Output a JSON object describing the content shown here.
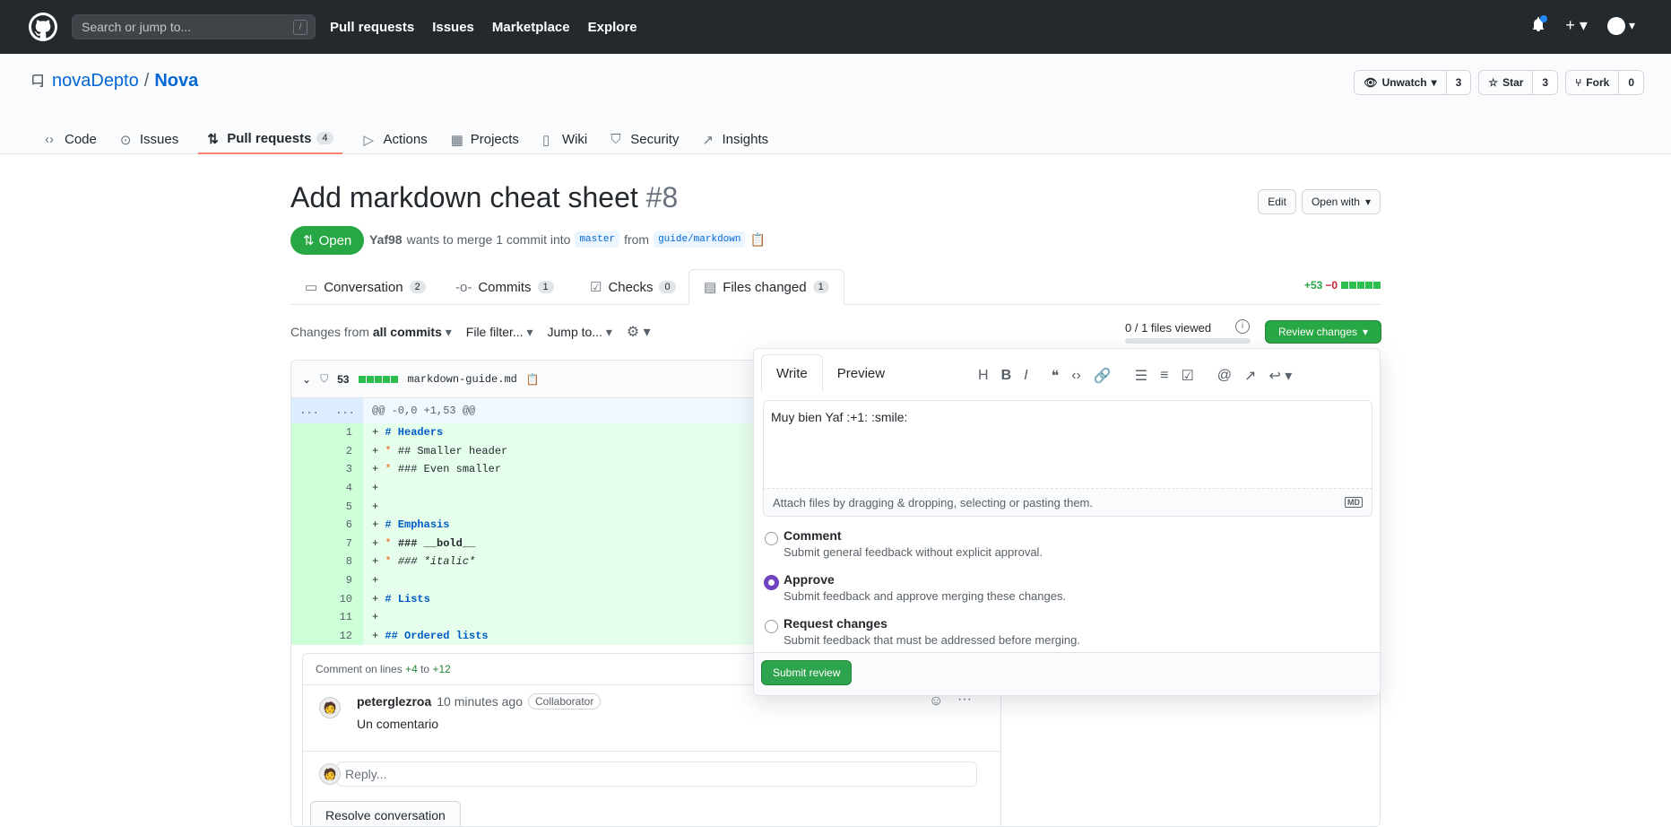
{
  "topbar": {
    "search_placeholder": "Search or jump to...",
    "slash_hint": "/",
    "nav": [
      "Pull requests",
      "Issues",
      "Marketplace",
      "Explore"
    ]
  },
  "repo": {
    "owner": "novaDepto",
    "separator": "/",
    "name": "Nova",
    "watch_label": "Unwatch",
    "watch_count": "3",
    "star_label": "Star",
    "star_count": "3",
    "fork_label": "Fork",
    "fork_count": "0",
    "nav": [
      {
        "label": "Code",
        "icon": "code-icon"
      },
      {
        "label": "Issues",
        "icon": "issue-icon"
      },
      {
        "label": "Pull requests",
        "count": "4",
        "icon": "pr-icon"
      },
      {
        "label": "Actions",
        "icon": "play-icon"
      },
      {
        "label": "Projects",
        "icon": "project-icon"
      },
      {
        "label": "Wiki",
        "icon": "book-icon"
      },
      {
        "label": "Security",
        "icon": "shield-icon"
      },
      {
        "label": "Insights",
        "icon": "graph-icon"
      }
    ]
  },
  "pr": {
    "title": "Add markdown cheat sheet",
    "number": "#8",
    "edit_label": "Edit",
    "open_with_label": "Open with",
    "state": "Open",
    "author": "Yaf98",
    "merge_text": "wants to merge 1 commit into",
    "base_branch": "master",
    "from_text": "from",
    "head_branch": "guide/markdown",
    "tabs": [
      {
        "label": "Conversation",
        "count": "2"
      },
      {
        "label": "Commits",
        "count": "1"
      },
      {
        "label": "Checks",
        "count": "0"
      },
      {
        "label": "Files changed",
        "count": "1"
      }
    ],
    "additions": "+53",
    "deletions": "−0"
  },
  "toolbar": {
    "changes_from": "Changes from",
    "all_commits": "all commits",
    "file_filter": "File filter...",
    "jump_to": "Jump to...",
    "files_viewed": "0 / 1 files viewed",
    "review_changes": "Review changes"
  },
  "file": {
    "lines_changed": "53",
    "filename": "markdown-guide.md",
    "hunk_left": "...",
    "hunk_right": "...",
    "hunk_header": "@@ -0,0 +1,53 @@",
    "lines": [
      {
        "n": "1",
        "prefix": "+ ",
        "bullet": "",
        "text": "# Headers",
        "kind": "kw"
      },
      {
        "n": "2",
        "prefix": "+ ",
        "bullet": "* ",
        "text": "## Smaller header",
        "kind": "plain"
      },
      {
        "n": "3",
        "prefix": "+ ",
        "bullet": "* ",
        "text": "### Even smaller",
        "kind": "plain"
      },
      {
        "n": "4",
        "prefix": "+",
        "bullet": "",
        "text": "",
        "kind": "plain"
      },
      {
        "n": "5",
        "prefix": "+",
        "bullet": "",
        "text": "",
        "kind": "plain"
      },
      {
        "n": "6",
        "prefix": "+ ",
        "bullet": "",
        "text": "# Emphasis",
        "kind": "kw"
      },
      {
        "n": "7",
        "prefix": "+ ",
        "bullet": "* ",
        "text": "### __bold__",
        "kind": "bold"
      },
      {
        "n": "8",
        "prefix": "+ ",
        "bullet": "* ",
        "text": "### *italic*",
        "kind": "italic"
      },
      {
        "n": "9",
        "prefix": "+",
        "bullet": "",
        "text": "",
        "kind": "plain"
      },
      {
        "n": "10",
        "prefix": "+ ",
        "bullet": "",
        "text": "# Lists",
        "kind": "kw"
      },
      {
        "n": "11",
        "prefix": "+",
        "bullet": "",
        "text": "",
        "kind": "plain"
      },
      {
        "n": "12",
        "prefix": "+ ",
        "bullet": "",
        "text": "## Ordered lists",
        "kind": "kw"
      }
    ]
  },
  "thread": {
    "comment_on": "Comment on lines",
    "from_line": "+4",
    "to_text": "to",
    "to_line": "+12",
    "author": "peterglezroa",
    "time": "10 minutes ago",
    "role": "Collaborator",
    "body": "Un comentario",
    "reply_placeholder": "Reply...",
    "resolve_label": "Resolve conversation"
  },
  "review": {
    "tab_write": "Write",
    "tab_preview": "Preview",
    "body": "Muy bien Yaf :+1: :smile:",
    "attach_hint": "Attach files by dragging & dropping, selecting or pasting them.",
    "markdown_badge": "MD",
    "options": [
      {
        "title": "Comment",
        "desc": "Submit general feedback without explicit approval.",
        "selected": false
      },
      {
        "title": "Approve",
        "desc": "Submit feedback and approve merging these changes.",
        "selected": true
      },
      {
        "title": "Request changes",
        "desc": "Submit feedback that must be addressed before merging.",
        "selected": false
      }
    ],
    "submit_label": "Submit review"
  },
  "colors": {
    "accent_green": "#28a745",
    "link_blue": "#0366d6",
    "radio_purple": "#6f42c1",
    "header_dark": "#24292e"
  }
}
